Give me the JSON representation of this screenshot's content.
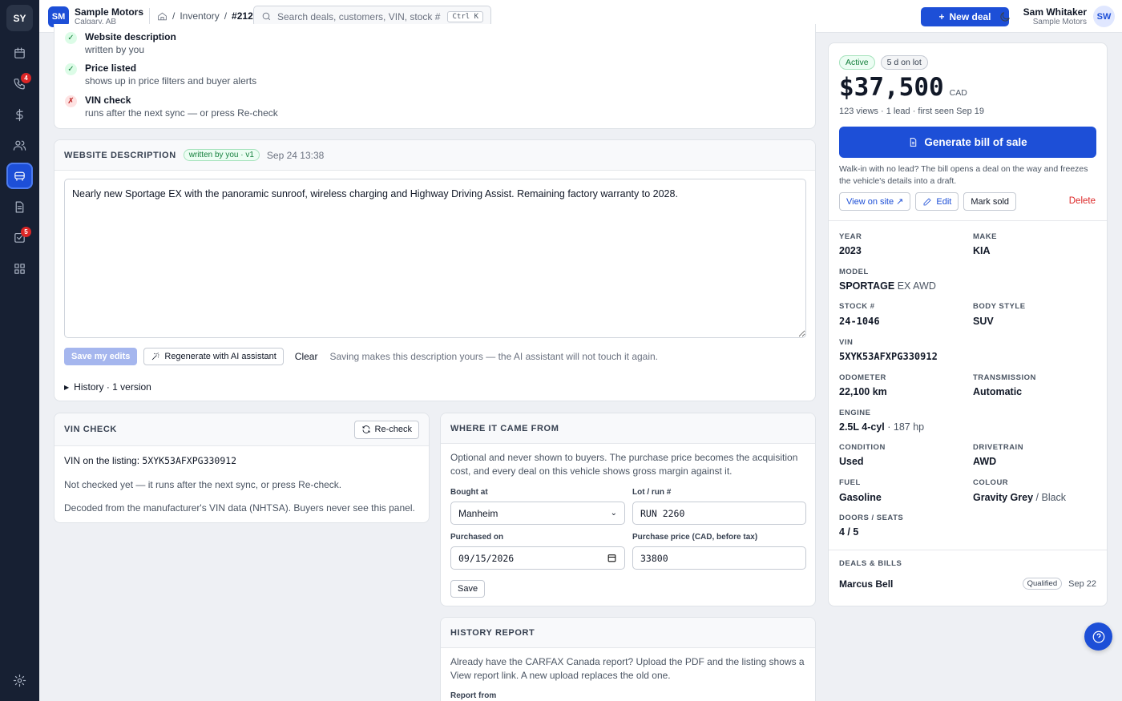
{
  "rail": {
    "logo": "SY",
    "badges": {
      "calls": "4",
      "tasks": "5"
    }
  },
  "header": {
    "org_initials": "SM",
    "org_name": "Sample Motors",
    "org_city": "Calgary, AB",
    "breadcrumb": {
      "sep": "/",
      "section": "Inventory",
      "current": "#212"
    },
    "search_placeholder": "Search deals, customers, VIN, stock #",
    "search_shortcut": "Ctrl K",
    "new_deal": "New deal",
    "user_name": "Sam Whitaker",
    "user_org": "Sample Motors",
    "user_initials": "SW"
  },
  "checklist": [
    {
      "status": "ok",
      "title": "Website description",
      "detail": "written by you"
    },
    {
      "status": "ok",
      "title": "Price listed",
      "detail": "shows up in price filters and buyer alerts"
    },
    {
      "status": "bad",
      "title": "VIN check",
      "detail": "runs after the next sync — or press Re-check"
    }
  ],
  "description": {
    "title": "WEBSITE DESCRIPTION",
    "badge": "written by you · v1",
    "timestamp": "Sep 24 13:38",
    "text": "Nearly new Sportage EX with the panoramic sunroof, wireless charging and Highway Driving Assist. Remaining factory warranty to 2028.",
    "save": "Save my edits",
    "regenerate": "Regenerate with AI assistant",
    "clear": "Clear",
    "hint": "Saving makes this description yours — the AI assistant will not touch it again.",
    "history": "History · 1 version"
  },
  "vin_check": {
    "title": "VIN CHECK",
    "recheck": "Re-check",
    "listing_label": "VIN on the listing:",
    "vin": "5XYK53AFXPG330912",
    "status": "Not checked yet — it runs after the next sync, or press Re-check.",
    "note": "Decoded from the manufacturer's VIN data (NHTSA). Buyers never see this panel."
  },
  "origin": {
    "title": "WHERE IT CAME FROM",
    "intro": "Optional and never shown to buyers. The purchase price becomes the acquisition cost, and every deal on this vehicle shows gross margin against it.",
    "bought_at_label": "Bought at",
    "bought_at": "Manheim",
    "lot_label": "Lot / run #",
    "lot": "RUN 2260",
    "purchased_on_label": "Purchased on",
    "purchased_on": "09/15/2026",
    "price_label": "Purchase price (CAD, before tax)",
    "price": "33800",
    "save": "Save"
  },
  "history_report": {
    "title": "HISTORY REPORT",
    "intro": "Already have the CARFAX Canada report? Upload the PDF and the listing shows a View report link. A new upload replaces the old one.",
    "report_from": "Report from"
  },
  "summary": {
    "status": "Active",
    "days": "5 d on lot",
    "price": "$37,500",
    "currency": "CAD",
    "stats": "123 views · 1 lead · first seen Sep 19",
    "bill_button": "Generate bill of sale",
    "bill_note": "Walk-in with no lead? The bill opens a deal on the way and freezes the vehicle's details into a draft.",
    "view_on_site": "View on site ↗",
    "edit": "Edit",
    "mark_sold": "Mark sold",
    "delete": "Delete"
  },
  "specs": {
    "year_label": "YEAR",
    "year": "2023",
    "make_label": "MAKE",
    "make": "KIA",
    "model_label": "MODEL",
    "model": "SPORTAGE",
    "trim": "EX AWD",
    "stock_label": "STOCK #",
    "stock": "24-1046",
    "body_label": "BODY STYLE",
    "body": "SUV",
    "vin_label": "VIN",
    "vin": "5XYK53AFXPG330912",
    "odo_label": "ODOMETER",
    "odo": "22,100 km",
    "trans_label": "TRANSMISSION",
    "trans": "Automatic",
    "engine_label": "ENGINE",
    "engine": "2.5L 4-cyl",
    "hp": "· 187 hp",
    "cond_label": "CONDITION",
    "cond": "Used",
    "drive_label": "DRIVETRAIN",
    "drive": "AWD",
    "fuel_label": "FUEL",
    "fuel": "Gasoline",
    "colour_label": "COLOUR",
    "colour": "Gravity Grey",
    "interior": "/ Black",
    "doors_label": "DOORS / SEATS",
    "doors": "4 / 5"
  },
  "deals": {
    "title": "DEALS & BILLS",
    "items": [
      {
        "name": "Marcus Bell",
        "status": "Qualified",
        "date": "Sep 22"
      }
    ]
  }
}
